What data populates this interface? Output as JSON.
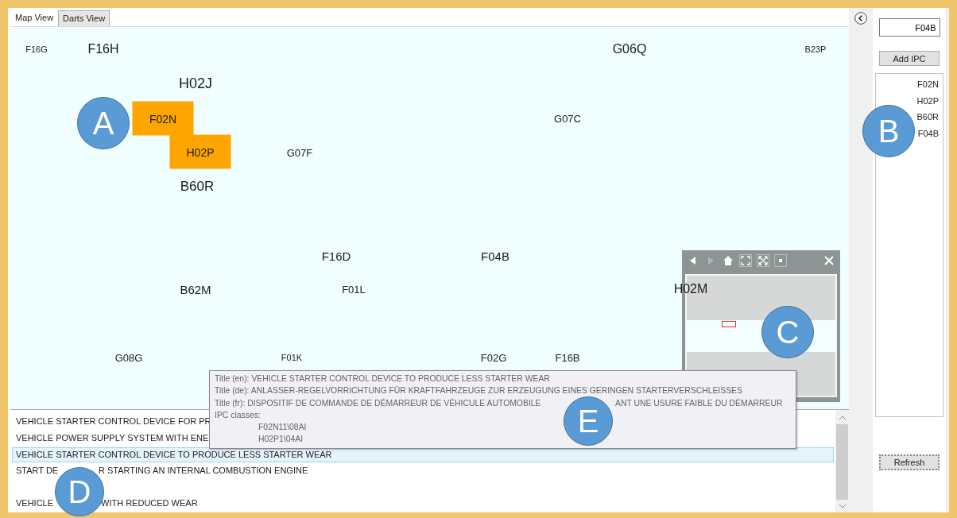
{
  "tabs": [
    {
      "label": "Map View",
      "selected": true
    },
    {
      "label": "Darts View",
      "selected": false
    }
  ],
  "map": {
    "labels": [
      {
        "code": "F16G",
        "highlighted": false
      },
      {
        "code": "F16H",
        "highlighted": false
      },
      {
        "code": "G06Q",
        "highlighted": false
      },
      {
        "code": "B23P",
        "highlighted": false
      },
      {
        "code": "H02J",
        "highlighted": false
      },
      {
        "code": "F02N",
        "highlighted": true
      },
      {
        "code": "G07C",
        "highlighted": false
      },
      {
        "code": "H02P",
        "highlighted": true
      },
      {
        "code": "G07F",
        "highlighted": false
      },
      {
        "code": "B60R",
        "highlighted": false
      },
      {
        "code": "F16D",
        "highlighted": false
      },
      {
        "code": "F04B",
        "highlighted": false
      },
      {
        "code": "B62M",
        "highlighted": false
      },
      {
        "code": "F01L",
        "highlighted": false
      },
      {
        "code": "H02M",
        "highlighted": false
      },
      {
        "code": "G08G",
        "highlighted": false
      },
      {
        "code": "F01K",
        "highlighted": false
      },
      {
        "code": "F02G",
        "highlighted": false
      },
      {
        "code": "F16B",
        "highlighted": false
      }
    ]
  },
  "results": [
    {
      "kind": "entry",
      "texts": [
        "VEHICLE STARTER CONTROL DEVICE FOR PR"
      ],
      "selected": false
    },
    {
      "kind": "entry",
      "texts": [
        "VEHICLE POWER SUPPLY SYSTEM WITH ENE"
      ],
      "selected": false
    },
    {
      "kind": "entry",
      "texts": [
        "VEHICLE STARTER CONTROL DEVICE TO PRODUCE LESS STARTER WEAR"
      ],
      "selected": true
    },
    {
      "kind": "entry",
      "texts": [
        "START DE",
        "R STARTING AN INTERNAL COMBUSTION ENGINE"
      ],
      "selected": false
    },
    {
      "kind": "blank",
      "selected": false
    },
    {
      "kind": "entry",
      "texts": [
        "VEHICLE",
        "WITH REDUCED WEAR"
      ],
      "selected": false
    }
  ],
  "tooltip": {
    "lines": [
      [
        "Title (en): VEHICLE STARTER CONTROL DEVICE TO PRODUCE LESS STARTER WEAR"
      ],
      [
        "Title (de): ANLASSER-REGELVORRICHTUNG FÜR KRAFTFAHRZEUGE ZUR ERZEUGUNG EINES GERINGEN STARTERVERSCHLEISSES"
      ],
      [
        "Title (fr): DISPOSITIF DE COMMANDE DE DÉMARREUR DE VÉHICULE AUTOMOBILE",
        "ANT UNE USURE FAIBLE DU DÉMARREUR"
      ]
    ],
    "ipc_heading": "IPC classes:",
    "ipc_classes": [
      "F02N11\\08AI",
      "H02P1\\04AI"
    ]
  },
  "side_panel": {
    "ipc_value": "F04B",
    "add_button": "Add IPC",
    "ipc_list": [
      "F02N",
      "H02P",
      "B60R",
      "F04B"
    ],
    "refresh_button": "Refresh"
  },
  "callouts": [
    "A",
    "B",
    "C",
    "D",
    "E"
  ]
}
